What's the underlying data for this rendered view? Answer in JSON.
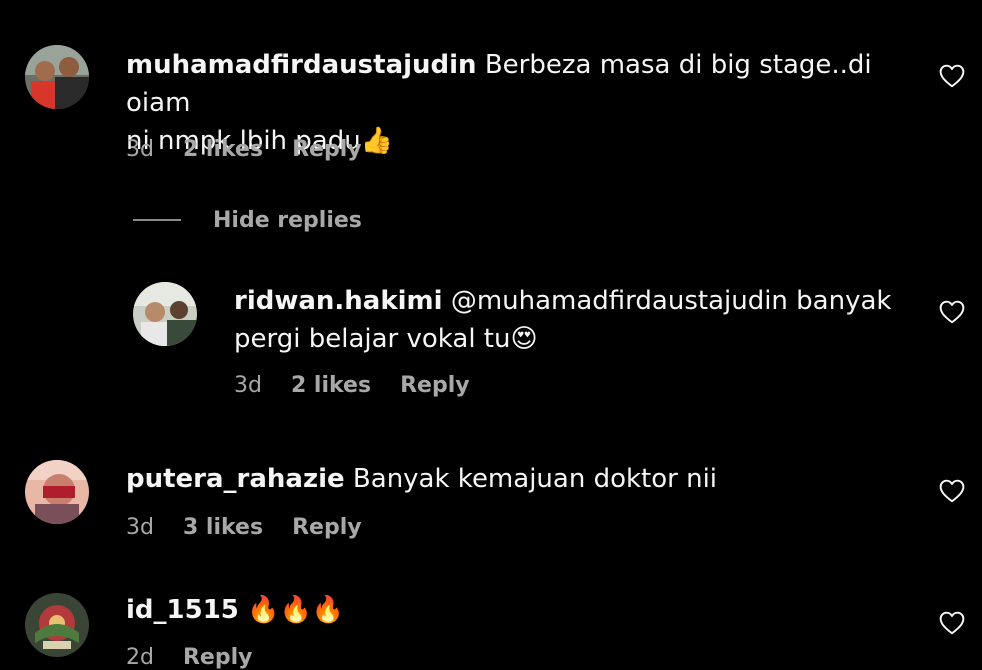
{
  "comments": [
    {
      "username": "muhamadfirdaustajudin",
      "text_line1": " Berbeza masa di big stage..di oiam",
      "text_line2": "ni nmpk lbih padu👍",
      "time": "3d",
      "likes": "2 likes",
      "reply": "Reply",
      "hide_replies": "Hide replies",
      "replies": [
        {
          "username": "ridwan.hakimi",
          "text_line1": " @muhamadfirdaustajudin banyak",
          "text_line2": "pergi belajar vokal tu😍",
          "time": "3d",
          "likes": "2 likes",
          "reply": "Reply"
        }
      ]
    },
    {
      "username": "putera_rahazie",
      "text": " Banyak kemajuan doktor nii",
      "time": "3d",
      "likes": "3 likes",
      "reply": "Reply"
    },
    {
      "username": "id_1515",
      "text": " 🔥🔥🔥",
      "time": "2d",
      "reply": "Reply"
    }
  ],
  "icons": {
    "like": "heart-outline-icon"
  },
  "colors": {
    "background": "#000000",
    "text": "#f5f5f5",
    "secondary": "#a8a8a8"
  }
}
